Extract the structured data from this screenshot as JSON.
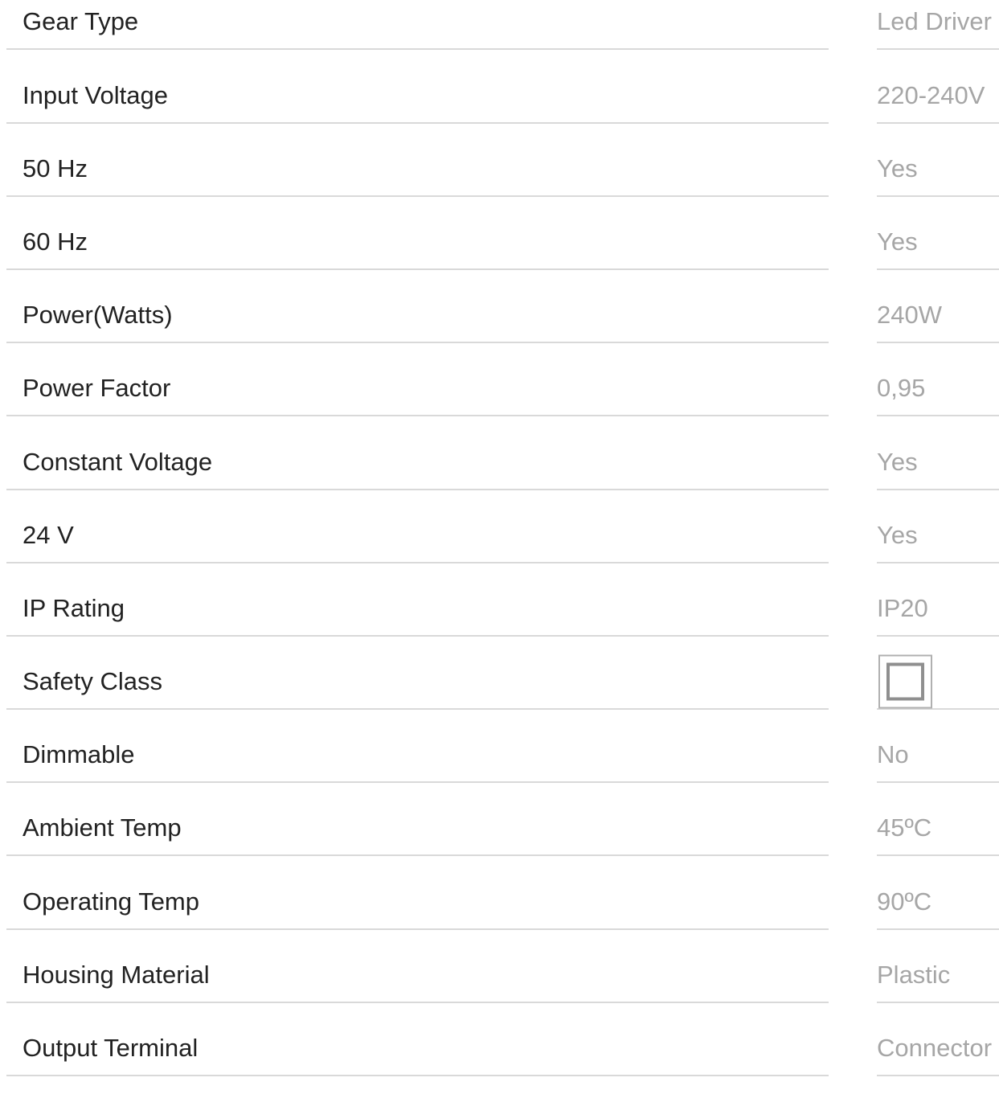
{
  "specs": [
    {
      "label": "Gear Type",
      "value": "Led Driver"
    },
    {
      "label": "Input Voltage",
      "value": "220-240V"
    },
    {
      "label": "50 Hz",
      "value": "Yes"
    },
    {
      "label": "60 Hz",
      "value": "Yes"
    },
    {
      "label": "Power(Watts)",
      "value": "240W"
    },
    {
      "label": "Power Factor",
      "value": "0,95"
    },
    {
      "label": "Constant Voltage",
      "value": "Yes"
    },
    {
      "label": "24 V",
      "value": "Yes"
    },
    {
      "label": "IP Rating",
      "value": "IP20"
    },
    {
      "label": "Safety Class",
      "value": "",
      "icon": "class-ii-double-square-icon"
    },
    {
      "label": "Dimmable",
      "value": "No"
    },
    {
      "label": "Ambient Temp",
      "value": "45ºC"
    },
    {
      "label": "Operating Temp",
      "value": "90ºC"
    },
    {
      "label": "Housing Material",
      "value": "Plastic"
    },
    {
      "label": "Output Terminal",
      "value": "Connector"
    }
  ],
  "colors": {
    "label_text": "#222222",
    "value_text": "#a6a6a6",
    "divider": "#d9d9d9"
  }
}
